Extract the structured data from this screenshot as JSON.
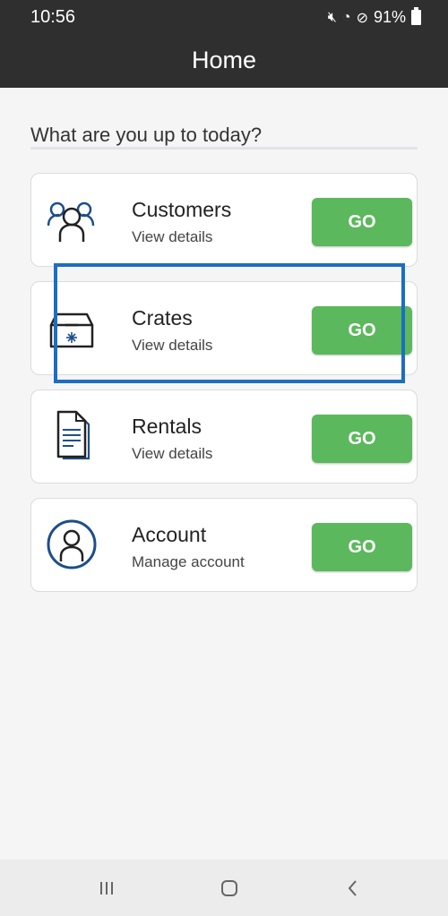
{
  "status_bar": {
    "time": "10:56",
    "battery": "91%"
  },
  "header": {
    "title": "Home"
  },
  "prompt": "What are you up to today?",
  "cards": [
    {
      "title": "Customers",
      "subtitle": "View details",
      "button": "GO",
      "icon": "customers-icon"
    },
    {
      "title": "Crates",
      "subtitle": "View details",
      "button": "GO",
      "icon": "crate-box-icon"
    },
    {
      "title": "Rentals",
      "subtitle": "View details",
      "button": "GO",
      "icon": "document-icon"
    },
    {
      "title": "Account",
      "subtitle": "Manage account",
      "button": "GO",
      "icon": "account-icon"
    }
  ],
  "colors": {
    "header_bg": "#2f2f2f",
    "go_button": "#5cb85c",
    "icon_blue": "#1d4e89",
    "highlight": "#1b6ec2"
  },
  "nav_bar": {
    "icons": [
      "recent-apps-icon",
      "home-icon",
      "back-icon"
    ]
  }
}
